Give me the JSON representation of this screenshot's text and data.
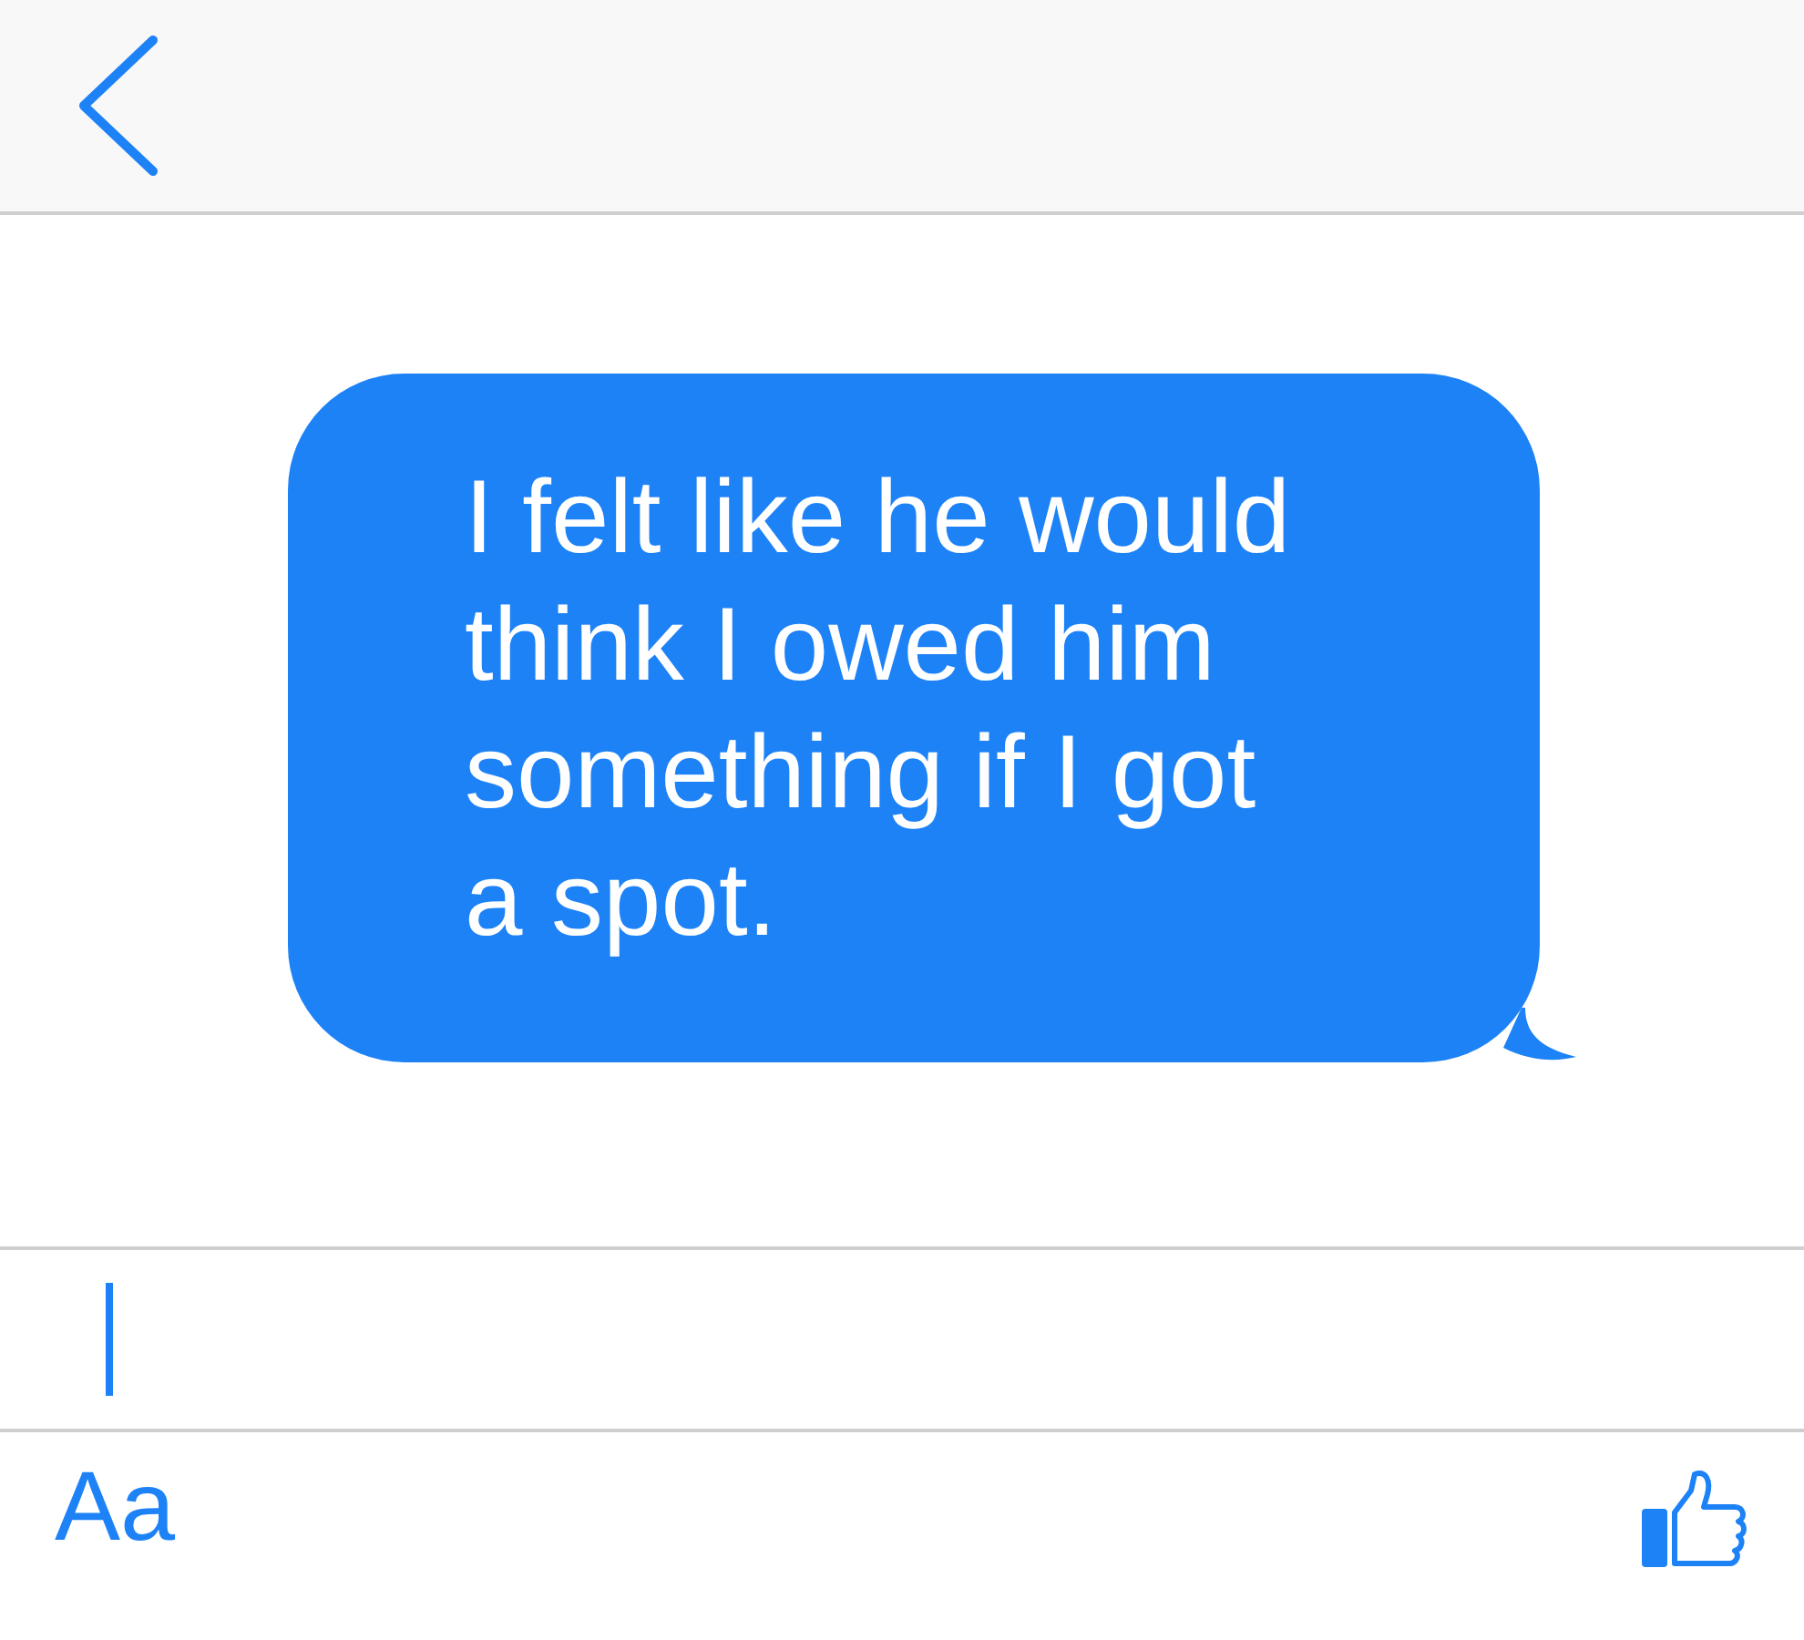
{
  "messages": [
    {
      "text": "I felt like he would think I owed him something if I got a spot.",
      "outgoing": true
    }
  ],
  "toolbar": {
    "format_label": "Aa"
  }
}
